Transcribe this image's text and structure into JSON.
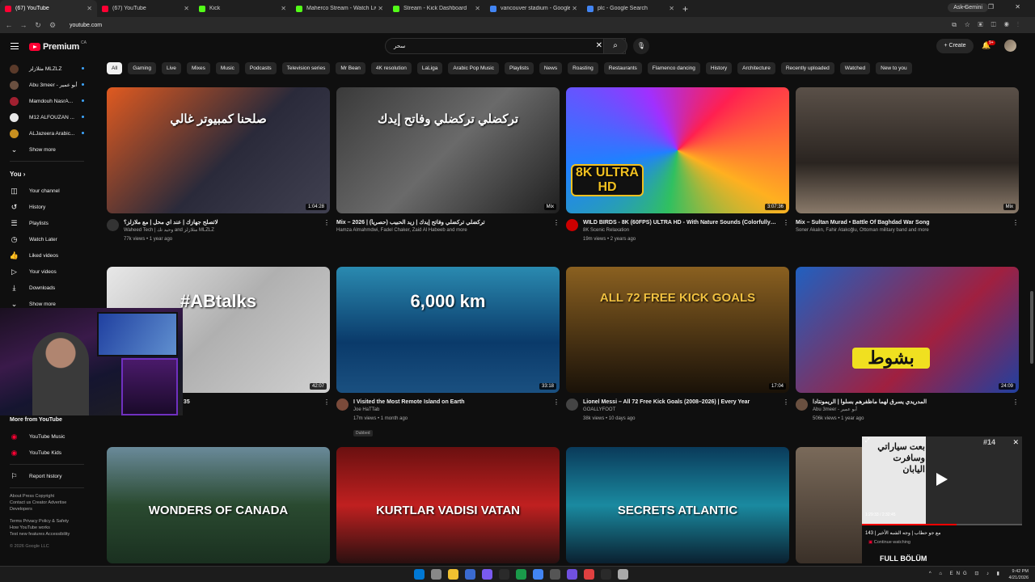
{
  "browser": {
    "tabs": [
      {
        "label": "(67) YouTube",
        "color": "#ff0033",
        "active": true
      },
      {
        "label": "(67) YouTube",
        "color": "#ff0033",
        "active": false
      },
      {
        "label": "Kick",
        "color": "#53fc18",
        "active": false
      },
      {
        "label": "Maherco Stream - Watch Live o...",
        "color": "#53fc18",
        "active": false
      },
      {
        "label": "Stream - Kick Dashboard",
        "color": "#53fc18",
        "active": false
      },
      {
        "label": "vancouver stadium - Google Se...",
        "color": "#4285f4",
        "active": false
      },
      {
        "label": "plc - Google Search",
        "color": "#4285f4",
        "active": false
      }
    ],
    "gemini_label": "Ask Gemini",
    "url": "youtube.com"
  },
  "header": {
    "logo_text": "Premium",
    "region": "CA",
    "search_query": "سحر",
    "create_label": "Create",
    "notif_count": "9+"
  },
  "chips": [
    "All",
    "Gaming",
    "Live",
    "Mixes",
    "Music",
    "Podcasts",
    "Television series",
    "Mr Bean",
    "4K resolution",
    "LaLiga",
    "Arabic Pop Music",
    "Playlists",
    "News",
    "Roasting",
    "Restaurants",
    "Flamenco dancing",
    "History",
    "Architecture",
    "Recently uploaded",
    "Watched",
    "New to you"
  ],
  "sidebar": {
    "subscriptions": [
      {
        "label": "مثلازلز MLZLZ",
        "color": "#5a3a2a"
      },
      {
        "label": "Abu 3meer - أبو عمير",
        "color": "#6a5040"
      },
      {
        "label": "Mamdouh NasrA...",
        "color": "#a02030"
      },
      {
        "label": "M12 ALFOUZAN ...",
        "color": "#e8e8e8"
      },
      {
        "label": "ALJazeera Arabic...",
        "color": "#c89020"
      }
    ],
    "show_more": "Show more",
    "you_label": "You",
    "you_items": [
      {
        "icon": "channel-icon",
        "label": "Your channel"
      },
      {
        "icon": "history-icon",
        "label": "History"
      },
      {
        "icon": "playlists-icon",
        "label": "Playlists"
      },
      {
        "icon": "watch-later-icon",
        "label": "Watch Later"
      },
      {
        "icon": "liked-icon",
        "label": "Liked videos"
      },
      {
        "icon": "your-videos-icon",
        "label": "Your videos"
      },
      {
        "icon": "downloads-icon",
        "label": "Downloads"
      }
    ],
    "show_more_2": "Show more",
    "more_from": "More from YouTube",
    "more_items": [
      {
        "label": "YouTube Music"
      },
      {
        "label": "YouTube Kids"
      }
    ],
    "report_history": "Report history",
    "footer1": "About  Press  Copyright",
    "footer2": "Contact us  Creator  Advertise",
    "footer3": "Developers",
    "footer4": "Terms  Privacy  Policy & Safety",
    "footer5": "How YouTube works",
    "footer6": "Test new features  Accessibility",
    "copyright": "© 2026 Google LLC"
  },
  "videos": [
    {
      "title": "لاتصلح جهازك | عند اي محل | مع ملازلز؟",
      "channel": "Waheed Tech | وحيد تك and مثلازلز MLZLZ",
      "stats": "77k views • 1 year ago",
      "duration": "1:04:28",
      "overlay": "صلحنا كمبيوتر غالي",
      "bg": "linear-gradient(135deg,#e05a20,#2a2a3a 55%,#404050)",
      "av": "#333"
    },
    {
      "title": "Mix – 2026 | تركضلي تركضلي وفاتح إيدك | زيد الحبيب (حصرياً)",
      "channel": "Hamza Almahmdwi, Fadel Chaker, Zaid Al Habeeb and more",
      "stats": "",
      "duration": "Mix",
      "overlay": "تركضلي تركضلي وفاتح إيدك",
      "bg": "linear-gradient(135deg,#3a3a3a,#6a6a6a 50%,#202020)",
      "av": ""
    },
    {
      "title": "WILD BIRDS - 8K (60FPS) ULTRA HD - With Nature Sounds (Colorfully Dynamic)",
      "channel": "8K Scenic Relaxation",
      "stats": "19m views • 2 years ago",
      "duration": "3:07:36",
      "overlay": "8K ULTRA HD",
      "bg": "conic-gradient(from 45deg,#ff2050,#ffb020,#30c060,#2080ff,#a030ff,#ff2050)",
      "av": "#cc0000"
    },
    {
      "title": "Mix – Sultan Murad • Battle Of Baghdad War Song",
      "channel": "Soner Akalın, Fahir Atakoğlu, Ottoman military band and more",
      "stats": "",
      "duration": "Mix",
      "overlay": "",
      "bg": "linear-gradient(180deg,#5a5048,#2a2420 60%,#8a7a6a)",
      "av": ""
    },
    {
      "title": "I Visited the Most Remote Island on Earth",
      "channel": "Joe HaTTab",
      "stats": "17m views • 1 month ago",
      "duration": "33:18",
      "overlay": "6,000 km",
      "bg": "linear-gradient(180deg,#2a8ab0,#0a3a6a 60%,#1a5080)",
      "av": "#7a4a3a",
      "dubbed": "Dubbed"
    },
    {
      "title": "Lionel Messi – All 72 Free Kick Goals (2008–2026) | Every Year",
      "channel": "GOALLYFOOT",
      "stats": "38k views • 10 days ago",
      "duration": "17:04",
      "overlay": "ALL 72 FREE KICK GOALS",
      "bg": "linear-gradient(180deg,#8a6020,#3a2810 70%,#1a1208)",
      "av": "#444"
    },
    {
      "title": "المدريدي يسرق لهما ماظفرهم بسلوا | الريمونتادا",
      "channel": "Abu 3meer - أبو عمير",
      "stats": "506k views • 1 year ago",
      "duration": "24:09",
      "overlay": "بشوط",
      "bg": "linear-gradient(135deg,#2060c0,#a02040 60%,#2040a0)",
      "av": "#6a5040"
    },
    {
      "title": "",
      "channel": "",
      "stats": "",
      "duration": "",
      "overlay": "WONDERS OF CANADA",
      "bg": "linear-gradient(180deg,#6a8a9a,#2a4a30 50%,#1a3020)",
      "av": ""
    },
    {
      "title": "",
      "channel": "",
      "stats": "",
      "duration": "",
      "overlay": "KURTLAR VADISI VATAN",
      "bg": "linear-gradient(180deg,#6a1010,#c02020 50%,#2a1010)",
      "av": ""
    },
    {
      "title": "",
      "channel": "",
      "stats": "",
      "duration": "",
      "overlay": "SECRETS ATLANTIC",
      "bg": "linear-gradient(180deg,#0a3a5a,#1a8aa0 50%,#0a2030)",
      "av": ""
    },
    {
      "title": "",
      "channel": "",
      "stats": "",
      "duration": "",
      "overlay": "",
      "bg": "linear-gradient(180deg,#7a6a5a,#3a3028)",
      "av": ""
    }
  ],
  "row2_first": {
    "title": "attab | مع جو حطاب | Chapter 35",
    "stats": "2.4m views • 5 years ago",
    "duration": "42:07",
    "overlay": "#ABtalks",
    "bg": "linear-gradient(135deg,#e8e8e8,#b0b0b0 50%,#d0d0d0)"
  },
  "miniplayer": {
    "time": "1:29:33 / 2:32:45",
    "title": "143 | مع جو حطاب | وجه الشبه الأخير",
    "continue": "Continue watching",
    "progress": 0.59,
    "full_label": "FULL BÖLÜM",
    "overlay": "بعت سياراتي وسافرت اليابان",
    "tag": "#14"
  },
  "taskbar": {
    "lang": "ENG",
    "time": "9:42 PM",
    "date": "4/21/2026"
  }
}
